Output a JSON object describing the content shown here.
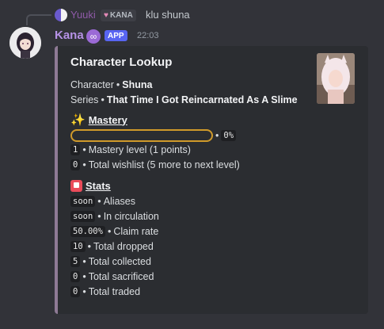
{
  "reply": {
    "username": "Yuuki",
    "tag": "KANA",
    "text": "klu shuna"
  },
  "message": {
    "username": "Kana",
    "badge": "APP",
    "timestamp": "22:03"
  },
  "embed": {
    "accent_color": "#8e7a95",
    "title": "Character Lookup",
    "character_label": "Character",
    "character_name": "Shuna",
    "series_label": "Series",
    "series_name": "That Time I Got Reincarnated As A Slime",
    "mastery": {
      "icon": "sparkles-icon",
      "heading": "Mastery",
      "progress_percent": 0,
      "progress_text": "0%",
      "level_value": "1",
      "level_text": "Mastery level (1 points)",
      "wishlist_value": "0",
      "wishlist_text": "Total wishlist (5 more to next level)"
    },
    "stats": {
      "icon": "bookmark-icon",
      "heading": "Stats",
      "rows": [
        {
          "value": "soon",
          "label": "Aliases"
        },
        {
          "value": "soon",
          "label": "In circulation"
        },
        {
          "value": "50.00%",
          "label": "Claim rate"
        },
        {
          "value": "10",
          "label": "Total dropped"
        },
        {
          "value": "5",
          "label": "Total collected"
        },
        {
          "value": "0",
          "label": "Total sacrificed"
        },
        {
          "value": "0",
          "label": "Total traded"
        }
      ]
    }
  },
  "separator": "•"
}
